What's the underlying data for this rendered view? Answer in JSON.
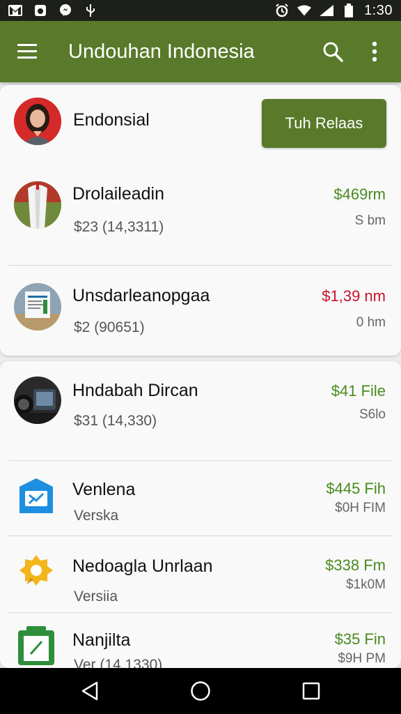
{
  "status_bar": {
    "time": "1:30",
    "left_icons": [
      "gmail-icon",
      "photo-icon",
      "messenger-icon",
      "usb-icon"
    ],
    "right_icons": [
      "alarm-icon",
      "wifi-icon",
      "signal-icon",
      "battery-icon"
    ]
  },
  "app_bar": {
    "title": "Undouhan Indonesia",
    "menu_icon": "menu-icon",
    "search_icon": "search-icon",
    "more_icon": "more-vert-icon"
  },
  "profile": {
    "name": "Endonsial",
    "action_button": "Tuh Relaas"
  },
  "rows": [
    {
      "title": "Drolaileadin",
      "subtitle": "$23 (14,3311)",
      "amount": "$469rm",
      "amount_color": "#4a8a1f",
      "meta": "S bm"
    },
    {
      "title": "Unsdarleanopgaa",
      "subtitle": "$2 (90651)",
      "amount": "$1,39 nm",
      "amount_color": "#c8102e",
      "meta": "0 hm"
    },
    {
      "title": "Hndabah Dircan",
      "subtitle": "$31 (14,330)",
      "amount": "$41 File",
      "amount_color": "#4a8a1f",
      "meta": "S6lo"
    },
    {
      "title": "Venlena",
      "subtitle": "Verska",
      "amount": "$445 Fih",
      "amount_color": "#4a8a1f",
      "meta": "$0H FIM",
      "icon": "mail-app-icon",
      "icon_color": "#1e8fe0"
    },
    {
      "title": "Nedoagla Unrlaan",
      "subtitle": "Versiia",
      "amount": "$338 Fm",
      "amount_color": "#4a8a1f",
      "meta": "$1k0M",
      "icon": "badge-app-icon",
      "icon_color": "#f2b51b"
    },
    {
      "title": "Nanjilta",
      "subtitle": "Ver (14,1330)",
      "amount": "$35 Fin",
      "amount_color": "#4a8a1f",
      "meta": "$9H PM",
      "icon": "notes-app-icon",
      "icon_color": "#2e8f3a"
    }
  ],
  "nav_bar": {
    "back_icon": "back-triangle-icon",
    "home_icon": "home-circle-icon",
    "recents_icon": "recents-square-icon"
  },
  "colors": {
    "accent": "#587a2a",
    "positive": "#4a8a1f",
    "negative": "#c8102e"
  }
}
